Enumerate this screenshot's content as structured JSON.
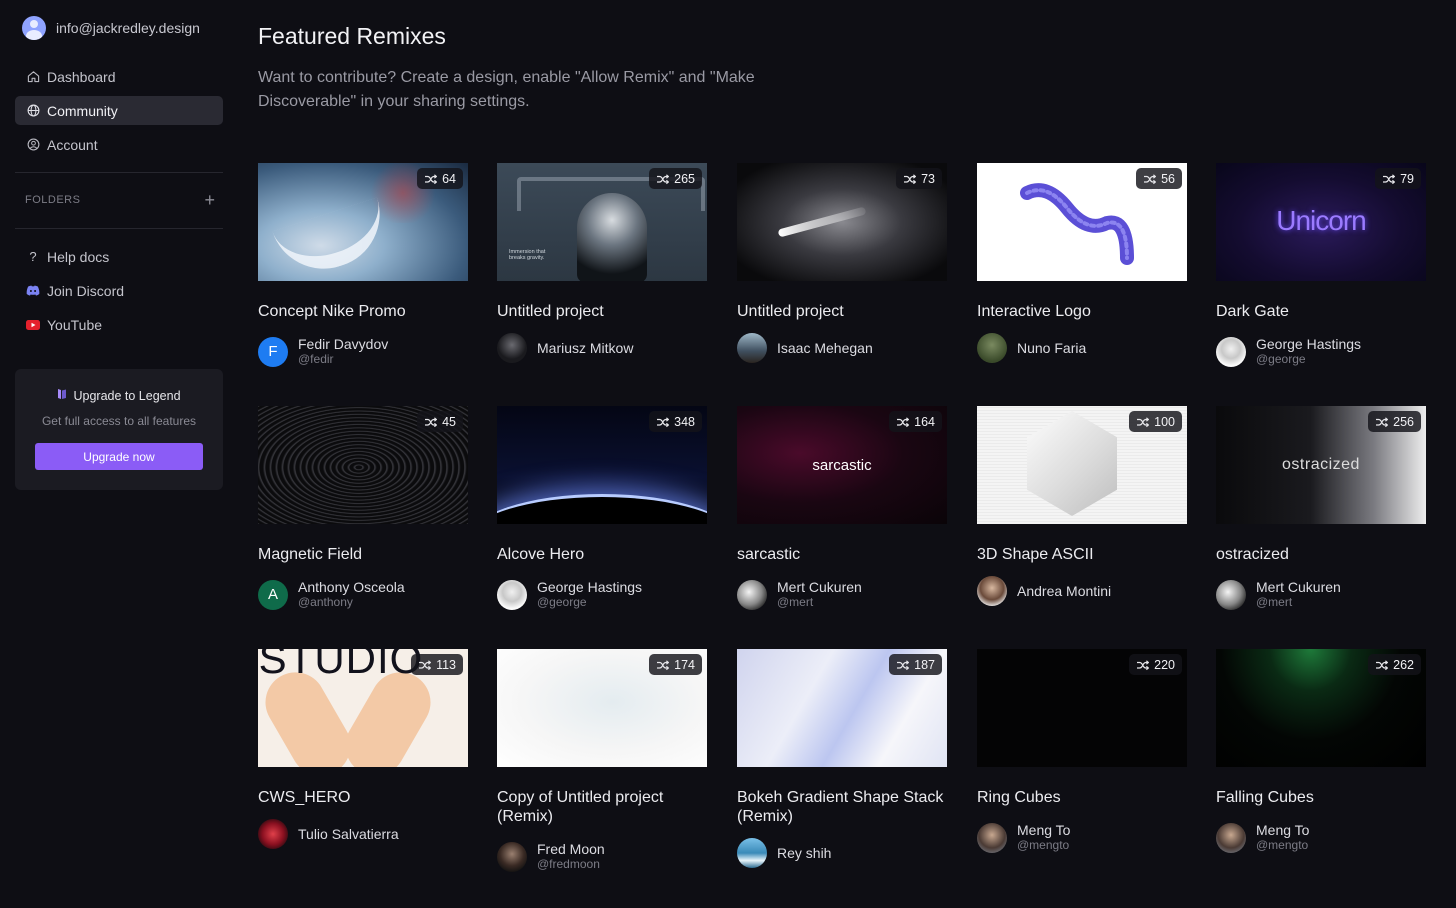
{
  "user": {
    "email": "info@jackredley.design"
  },
  "nav": [
    {
      "label": "Dashboard",
      "icon": "home-icon",
      "active": false
    },
    {
      "label": "Community",
      "icon": "globe-icon",
      "active": true
    },
    {
      "label": "Account",
      "icon": "account-icon",
      "active": false
    }
  ],
  "folders": {
    "label": "FOLDERS"
  },
  "links": [
    {
      "label": "Help docs",
      "icon": "question-icon"
    },
    {
      "label": "Join Discord",
      "icon": "discord-icon"
    },
    {
      "label": "YouTube",
      "icon": "youtube-icon"
    }
  ],
  "upgrade": {
    "title": "Upgrade to Legend",
    "subtitle": "Get full access to all features",
    "button": "Upgrade now",
    "accent": "#8b5cf6"
  },
  "page": {
    "title": "Featured Remixes",
    "description": "Want to contribute? Create a design, enable \"Allow Remix\" and \"Make Discoverable\" in your sharing settings."
  },
  "cards": [
    {
      "title": "Concept Nike Promo",
      "remixes": "64",
      "author": "Fedir Davydov",
      "handle": "@fedir",
      "avatar_letter": "F"
    },
    {
      "title": "Untitled project",
      "remixes": "265",
      "author": "Mariusz Mitkow",
      "handle": "",
      "thumb_text": "Immersion that breaks gravity."
    },
    {
      "title": "Untitled project",
      "remixes": "73",
      "author": "Isaac Mehegan",
      "handle": ""
    },
    {
      "title": "Interactive Logo",
      "remixes": "56",
      "author": "Nuno Faria",
      "handle": ""
    },
    {
      "title": "Dark Gate",
      "remixes": "79",
      "author": "George Hastings",
      "handle": "@george",
      "thumb_text": "Unicorn"
    },
    {
      "title": "Magnetic Field",
      "remixes": "45",
      "author": "Anthony Osceola",
      "handle": "@anthony",
      "avatar_letter": "A"
    },
    {
      "title": "Alcove Hero",
      "remixes": "348",
      "author": "George Hastings",
      "handle": "@george"
    },
    {
      "title": "sarcastic",
      "remixes": "164",
      "author": "Mert Cukuren",
      "handle": "@mert",
      "thumb_text": "sarcastic"
    },
    {
      "title": "3D Shape ASCII",
      "remixes": "100",
      "author": "Andrea Montini",
      "handle": ""
    },
    {
      "title": "ostracized",
      "remixes": "256",
      "author": "Mert Cukuren",
      "handle": "@mert",
      "thumb_text": "ostracized"
    },
    {
      "title": "CWS_HERO",
      "remixes": "113",
      "author": "Tulio Salvatierra",
      "handle": "",
      "thumb_text": "STUDIO"
    },
    {
      "title": "Copy of Untitled project (Remix)",
      "remixes": "174",
      "author": "Fred Moon",
      "handle": "@fredmoon"
    },
    {
      "title": "Bokeh Gradient Shape Stack (Remix)",
      "remixes": "187",
      "author": "Rey shih",
      "handle": ""
    },
    {
      "title": "Ring Cubes",
      "remixes": "220",
      "author": "Meng To",
      "handle": "@mengto"
    },
    {
      "title": "Falling Cubes",
      "remixes": "262",
      "author": "Meng To",
      "handle": "@mengto"
    }
  ]
}
